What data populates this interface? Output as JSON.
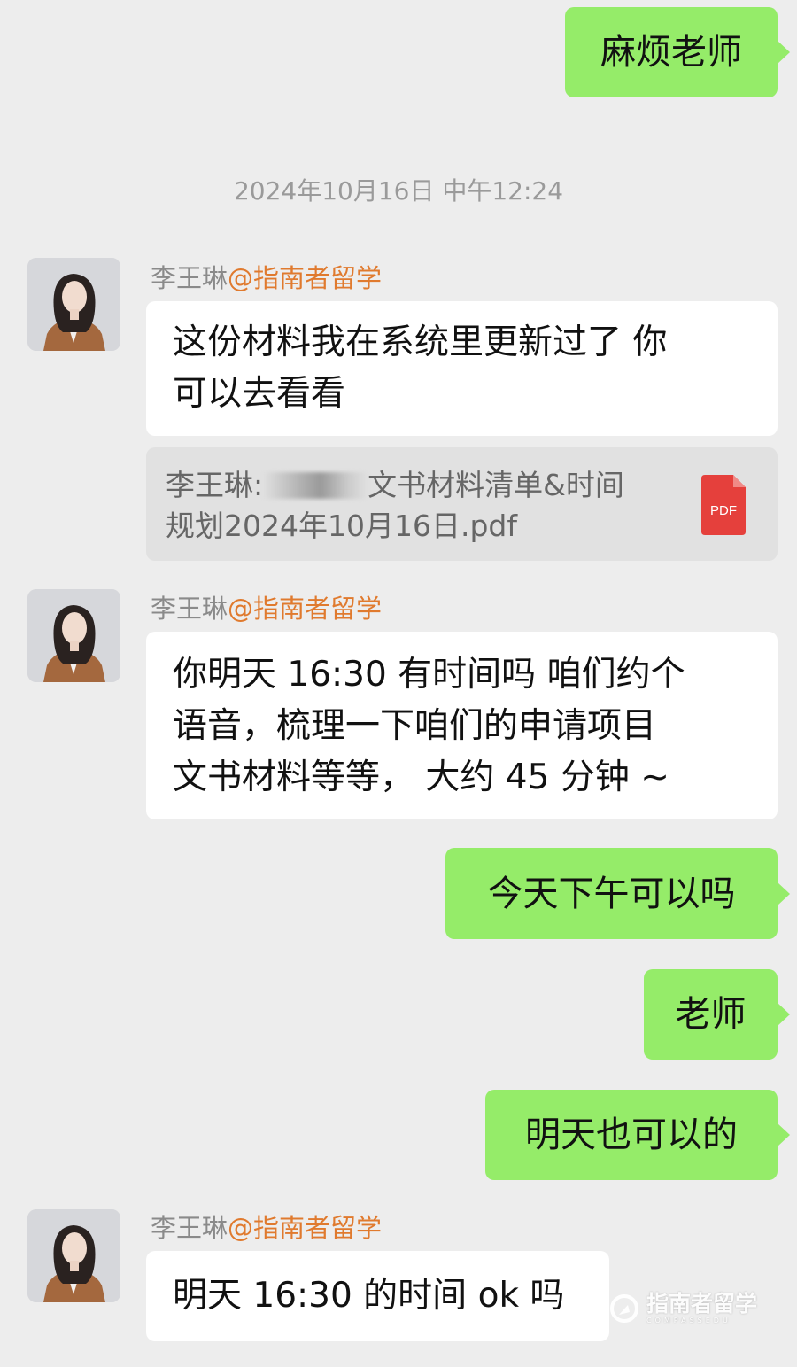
{
  "messages": {
    "m1": "麻烦老师",
    "timestamp": "2024年10月16日 中午12:24",
    "sender_name": "李王琳",
    "sender_org": "@指南者留学",
    "m2_line1": "这份材料我在系统里更新过了 你",
    "m2_line2": "可以去看看",
    "file_prefix": "李王琳:",
    "file_name_part1": "文书材料清单&时间",
    "file_name_part2": "规划2024年10月16日.pdf",
    "file_badge": "PDF",
    "m3_line1": "你明天 16:30 有时间吗 咱们约个",
    "m3_line2": "语音，梳理一下咱们的申请项目",
    "m3_line3": "文书材料等等， 大约 45 分钟 ~",
    "m4": "今天下午可以吗",
    "m5": "老师",
    "m6": "明天也可以的",
    "m7": "明天 16:30 的时间 ok 吗"
  },
  "watermark": {
    "brand": "指南者留学",
    "sub": "COMPASSEDU"
  },
  "colors": {
    "background": "#ededed",
    "sent_bubble": "#95ec69",
    "received_bubble": "#ffffff",
    "org_name": "#e07a2e",
    "pdf_red": "#e5403c"
  }
}
